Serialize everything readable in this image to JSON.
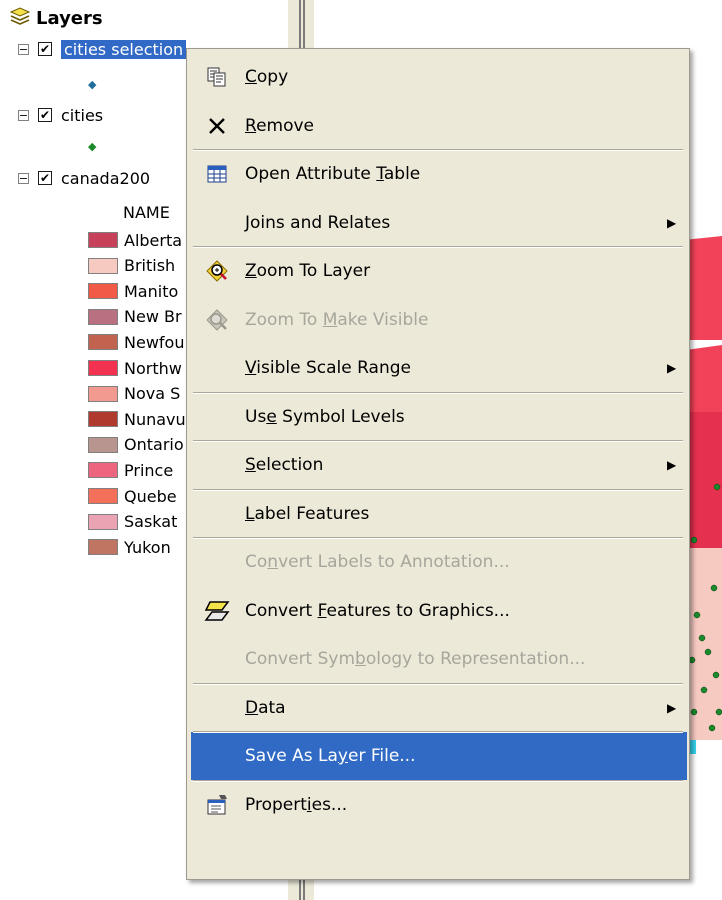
{
  "toc": {
    "title": "Layers",
    "layers": [
      {
        "name": "cities selection",
        "expander": "−",
        "checked": "✔"
      },
      {
        "name": "cities",
        "expander": "−",
        "checked": "✔"
      },
      {
        "name": "canada200",
        "expander": "−",
        "checked": "✔"
      }
    ],
    "legend_field": "NAME",
    "legend": [
      {
        "label": "Alberta",
        "color": "#c8415a"
      },
      {
        "label": "British",
        "color": "#f6c9c1"
      },
      {
        "label": "Manito",
        "color": "#f05a46"
      },
      {
        "label": "New Br",
        "color": "#b97080"
      },
      {
        "label": "Newfou",
        "color": "#c2634f"
      },
      {
        "label": "Northw",
        "color": "#f33150"
      },
      {
        "label": "Nova S",
        "color": "#f29a90"
      },
      {
        "label": "Nunavu",
        "color": "#b03a2e"
      },
      {
        "label": "Ontario",
        "color": "#b8968f"
      },
      {
        "label": "Prince",
        "color": "#ee6580"
      },
      {
        "label": "Quebe",
        "color": "#f5705a"
      },
      {
        "label": "Saskat",
        "color": "#eaa3b2"
      },
      {
        "label": "Yukon",
        "color": "#c07563"
      }
    ]
  },
  "menu": {
    "items": [
      {
        "pre": "",
        "u": "C",
        "post": "opy",
        "icon": "copy-icon",
        "state": "normal"
      },
      {
        "pre": "",
        "u": "R",
        "post": "emove",
        "icon": "remove-icon",
        "state": "normal"
      },
      {
        "pre": "Open Attribute ",
        "u": "T",
        "post": "able",
        "icon": "table-icon",
        "state": "normal"
      },
      {
        "pre": "",
        "u": "J",
        "post": "oins and Relates",
        "icon": "",
        "state": "normal",
        "submenu": "▶"
      },
      {
        "pre": "",
        "u": "Z",
        "post": "oom To Layer",
        "icon": "zoom-to-layer-icon",
        "state": "normal"
      },
      {
        "pre": "Zoom To ",
        "u": "M",
        "post": "ake Visible",
        "icon": "zoom-make-visible-icon",
        "state": "disabled"
      },
      {
        "pre": "",
        "u": "V",
        "post": "isible Scale Range",
        "icon": "",
        "state": "normal",
        "submenu": "▶"
      },
      {
        "pre": "Us",
        "u": "e",
        "post": " Symbol Levels",
        "icon": "",
        "state": "normal"
      },
      {
        "pre": "",
        "u": "S",
        "post": "election",
        "icon": "",
        "state": "normal",
        "submenu": "▶"
      },
      {
        "pre": "",
        "u": "L",
        "post": "abel Features",
        "icon": "",
        "state": "normal"
      },
      {
        "pre": "Co",
        "u": "n",
        "post": "vert Labels to Annotation...",
        "icon": "",
        "state": "disabled"
      },
      {
        "pre": "Convert ",
        "u": "F",
        "post": "eatures to Graphics...",
        "icon": "convert-graphics-icon",
        "state": "normal"
      },
      {
        "pre": "Convert Sym",
        "u": "b",
        "post": "ology to Representation...",
        "icon": "",
        "state": "disabled"
      },
      {
        "pre": "",
        "u": "D",
        "post": "ata",
        "icon": "",
        "state": "normal",
        "submenu": "▶"
      },
      {
        "pre": "Save As La",
        "u": "y",
        "post": "er File...",
        "icon": "",
        "state": "highlighted"
      },
      {
        "pre": "Propert",
        "u": "i",
        "post": "es...",
        "icon": "properties-icon",
        "state": "normal"
      }
    ]
  }
}
